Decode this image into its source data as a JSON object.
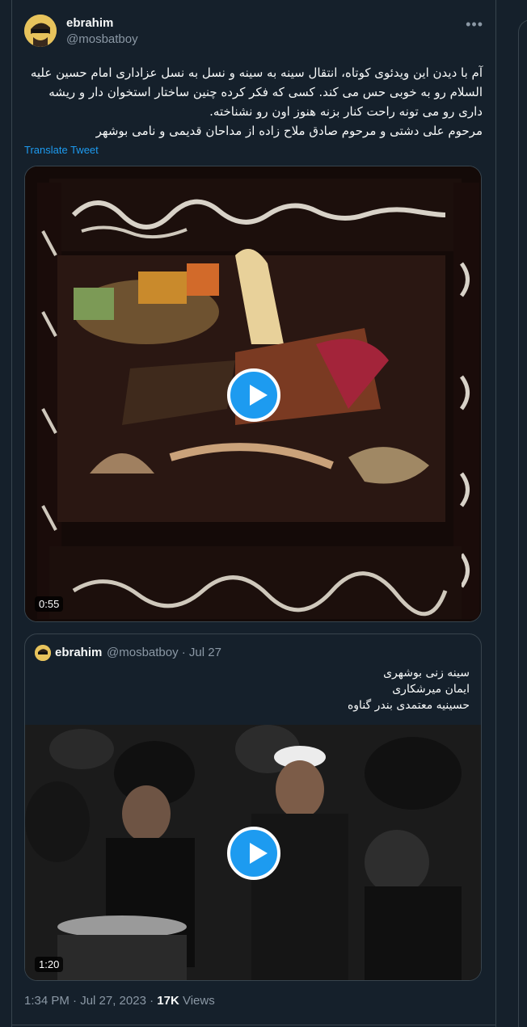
{
  "author": {
    "display_name": "ebrahim",
    "handle": "@mosbatboy"
  },
  "tweet": {
    "text_lines": [
      "آم با دیدن این ویدئوی کوتاه، انتقال سینه به سینه و نسل به نسل عزاداری امام حسین علیه السلام رو به خوبی حس می کند. کسی که فکر کرده چنین ساختار استخوان دار و ریشه داری رو می تونه راحت کنار بزنه هنوز اون رو نشناخته.",
      "مرحوم علی دشتی و مرحوم صادق ملاح زاده از مداحان قدیمی و نامی بوشهر"
    ],
    "translate_label": "Translate Tweet",
    "video_duration": "0:55"
  },
  "quoted_tweet": {
    "display_name": "ebrahim",
    "handle_date": "@mosbatboy · Jul 27",
    "text_lines": [
      "سینه زنی بوشهری",
      "ایمان میرشکاری",
      "حسینیه معتمدی بندر گناوه"
    ],
    "video_duration": "1:20"
  },
  "meta": {
    "timestamp": "1:34 PM · Jul 27, 2023 · ",
    "views_count": "17K",
    "views_label": " Views"
  },
  "icons": {
    "more": "more-icon",
    "play": "play-icon"
  },
  "colors": {
    "background": "#15202b",
    "accent": "#1d9bf0",
    "secondary_text": "#8b98a5",
    "border": "#38444d"
  }
}
